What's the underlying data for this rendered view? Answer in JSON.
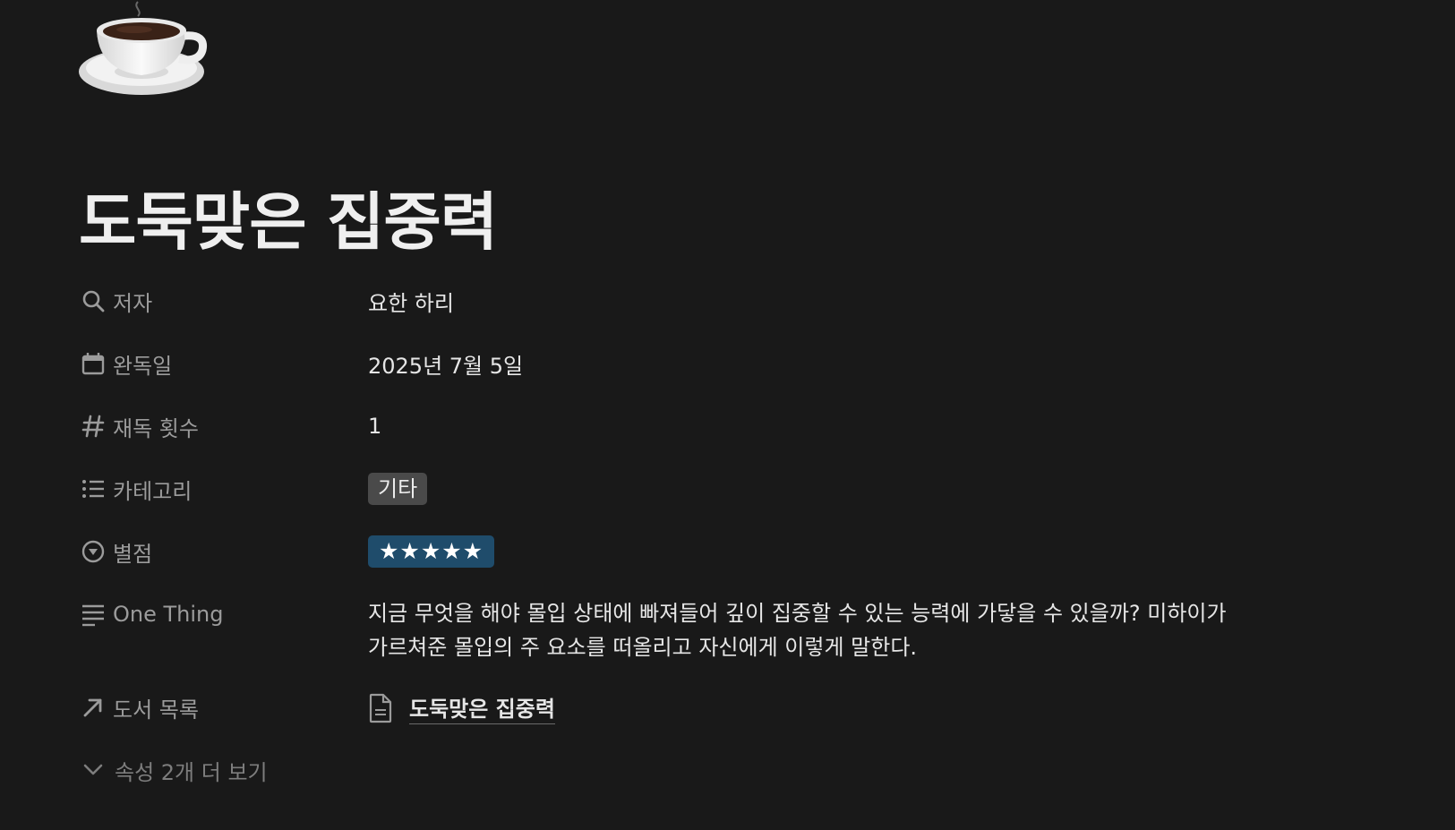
{
  "page": {
    "icon": "coffee-cup-icon",
    "title": "도둑맞은 집중력"
  },
  "properties": {
    "author": {
      "label": "저자",
      "icon": "search-icon",
      "value": "요한 하리"
    },
    "finished_date": {
      "label": "완독일",
      "icon": "calendar-icon",
      "value": "2025년 7월 5일"
    },
    "reread_count": {
      "label": "재독 횟수",
      "icon": "hash-icon",
      "value": "1"
    },
    "category": {
      "label": "카테고리",
      "icon": "list-icon",
      "value": "기타"
    },
    "rating": {
      "label": "별점",
      "icon": "select-circle-icon",
      "value": "★★★★★",
      "stars": 5
    },
    "one_thing": {
      "label": "One Thing",
      "icon": "text-lines-icon",
      "line1": "지금 무엇을 해야 몰입 상태에 빠져들어 깊이 집중할 수 있는 능력에 가닿을 수 있을까? 미하이가",
      "line2": "가르쳐준 몰입의 주 요소를 떠올리고 자신에게 이렇게 말한다."
    },
    "book_list": {
      "label": "도서 목록",
      "icon": "arrow-up-right-icon",
      "value": "도둑맞은 집중력"
    }
  },
  "more": {
    "label": "속성 2개 더 보기",
    "icon": "chevron-down-icon"
  },
  "colors": {
    "background": "#191919",
    "label": "#9b9b9b",
    "tag_bg": "#4a4a4a",
    "rating_bg": "#1f4c6b"
  }
}
